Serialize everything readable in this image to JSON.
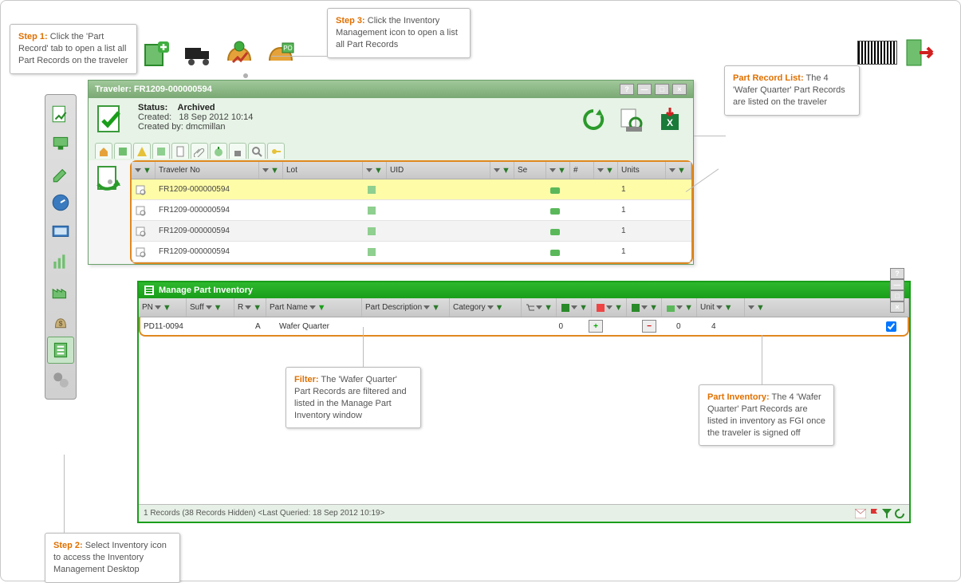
{
  "callouts": {
    "step1": {
      "label": "Step 1:",
      "text": "Click the 'Part Record' tab to open a list all Part Records on the traveler"
    },
    "step2": {
      "label": "Step 2:",
      "text": "Select Inventory icon to access the Inventory Management Desktop"
    },
    "step3": {
      "label": "Step 3:",
      "text": "Click the Inventory Management icon to open a list all Part Records"
    },
    "partList": {
      "label": "Part Record List:",
      "text": "The 4 'Wafer Quarter' Part Records are listed on the traveler"
    },
    "filter": {
      "label": "Filter:",
      "text": "The 'Wafer Quarter' Part Records are filtered and listed in the Manage Part Inventory window"
    },
    "inv": {
      "label": "Part Inventory:",
      "text": "The 4 'Wafer Quarter' Part Records are listed in inventory as FGI once the traveler is signed off"
    }
  },
  "traveler": {
    "title": "Traveler: FR1209-000000594",
    "status_label": "Status:",
    "status_value": "Archived",
    "created_label": "Created:",
    "created_value": "18 Sep 2012 10:14",
    "createdby_label": "Created by:",
    "createdby_value": "dmcmillan",
    "columns": {
      "travno": "Traveler No",
      "lot": "Lot",
      "uid": "UID",
      "se": "Se",
      "hash": "#",
      "units": "Units"
    },
    "rows": [
      {
        "travno": "FR1209-000000594",
        "units": "1"
      },
      {
        "travno": "FR1209-000000594",
        "units": "1"
      },
      {
        "travno": "FR1209-000000594",
        "units": "1"
      },
      {
        "travno": "FR1209-000000594",
        "units": "1"
      }
    ]
  },
  "mpi": {
    "title": "Manage Part Inventory",
    "columns": {
      "pn": "PN",
      "suff": "Suff",
      "r": "R",
      "name": "Part Name",
      "desc": "Part Description",
      "cat": "Category",
      "unit": "Unit"
    },
    "row": {
      "pn": "PD11-0094",
      "r": "A",
      "name": "Wafer Quarter",
      "q1": "0",
      "q2": "0",
      "q3": "4"
    },
    "status": "1 Records (38 Records Hidden) <Last Queried: 18 Sep 2012 10:19>"
  }
}
